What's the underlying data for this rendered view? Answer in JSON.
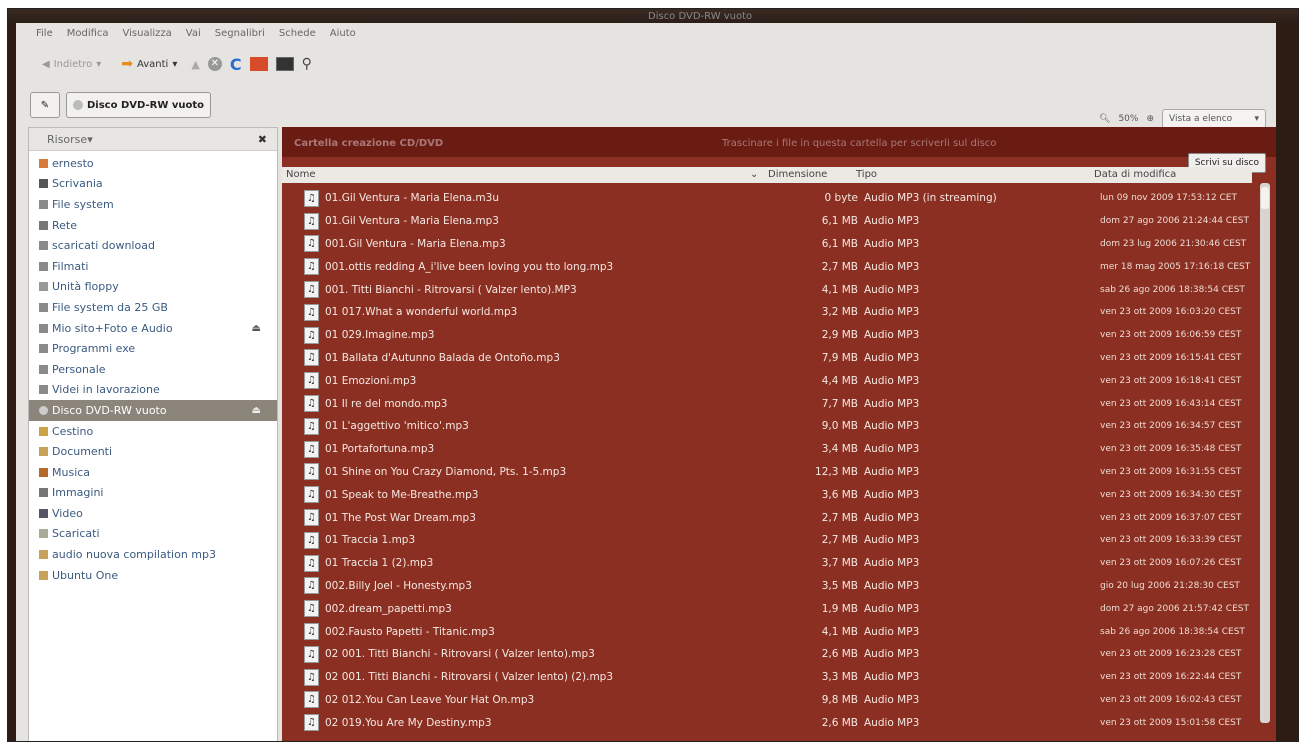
{
  "window": {
    "title": "Disco DVD-RW vuoto"
  },
  "menu": [
    "File",
    "Modifica",
    "Visualizza",
    "Vai",
    "Segnalibri",
    "Schede",
    "Aiuto"
  ],
  "toolbar": {
    "back": "Indietro",
    "forward": "Avanti"
  },
  "path": {
    "location": "Disco DVD-RW vuoto"
  },
  "view": {
    "zoom": "50%",
    "mode": "Vista a elenco"
  },
  "sidebar": {
    "header": "Risorse",
    "items": [
      {
        "label": "ernesto",
        "icon": "home-icon"
      },
      {
        "label": "Scrivania",
        "icon": "desktop-icon"
      },
      {
        "label": "File system",
        "icon": "drive-icon"
      },
      {
        "label": "Rete",
        "icon": "network-icon"
      },
      {
        "label": "scaricati download",
        "icon": "drive-icon"
      },
      {
        "label": "Filmati",
        "icon": "drive-icon"
      },
      {
        "label": "Unità floppy",
        "icon": "floppy-icon"
      },
      {
        "label": "File system da 25 GB",
        "icon": "drive-icon"
      },
      {
        "label": "Mio sito+Foto e Audio",
        "icon": "drive-icon",
        "eject": true
      },
      {
        "label": "Programmi exe",
        "icon": "drive-icon"
      },
      {
        "label": "Personale",
        "icon": "drive-icon"
      },
      {
        "label": "Videi in lavorazione",
        "icon": "drive-icon"
      },
      {
        "label": "Disco DVD-RW vuoto",
        "icon": "disc-icon",
        "eject": true,
        "selected": true
      },
      {
        "label": "Cestino",
        "icon": "trash-icon"
      },
      {
        "label": "Documenti",
        "icon": "folder-icon"
      },
      {
        "label": "Musica",
        "icon": "music-folder-icon"
      },
      {
        "label": "Immagini",
        "icon": "images-folder-icon"
      },
      {
        "label": "Video",
        "icon": "video-folder-icon"
      },
      {
        "label": "Scaricati",
        "icon": "downloads-folder-icon"
      },
      {
        "label": "audio nuova compilation mp3",
        "icon": "folder-icon"
      },
      {
        "label": "Ubuntu One",
        "icon": "folder-icon"
      }
    ]
  },
  "content": {
    "bar_title": "Cartella creazione CD/DVD",
    "bar_message": "Trascinare i file in questa cartella per scriverli sul disco",
    "write_button": "Scrivi su disco",
    "columns": {
      "name": "Nome",
      "size": "Dimensione",
      "type": "Tipo",
      "date": "Data di modifica"
    },
    "files": [
      {
        "name": "01.Gil Ventura - Maria Elena.m3u",
        "size": "0 byte",
        "type": "Audio MP3 (in streaming)",
        "date": "lun 09 nov 2009 17:53:12 CET"
      },
      {
        "name": "01.Gil Ventura - Maria Elena.mp3",
        "size": "6,1 MB",
        "type": "Audio MP3",
        "date": "dom 27 ago 2006 21:24:44 CEST"
      },
      {
        "name": "001.Gil Ventura - Maria Elena.mp3",
        "size": "6,1 MB",
        "type": "Audio MP3",
        "date": "dom 23 lug 2006 21:30:46 CEST"
      },
      {
        "name": "001.ottis redding A_i'live been loving you tto long.mp3",
        "size": "2,7 MB",
        "type": "Audio MP3",
        "date": "mer 18 mag 2005 17:16:18 CEST"
      },
      {
        "name": "001. Titti Bianchi - Ritrovarsi ( Valzer lento).MP3",
        "size": "4,1 MB",
        "type": "Audio MP3",
        "date": "sab 26 ago 2006 18:38:54 CEST"
      },
      {
        "name": "01 017.What a wonderful world.mp3",
        "size": "3,2 MB",
        "type": "Audio MP3",
        "date": "ven 23 ott 2009 16:03:20 CEST"
      },
      {
        "name": "01 029.Imagine.mp3",
        "size": "2,9 MB",
        "type": "Audio MP3",
        "date": "ven 23 ott 2009 16:06:59 CEST"
      },
      {
        "name": "01 Ballata d'Autunno Balada de Ontoño.mp3",
        "size": "7,9 MB",
        "type": "Audio MP3",
        "date": "ven 23 ott 2009 16:15:41 CEST"
      },
      {
        "name": "01 Emozioni.mp3",
        "size": "4,4 MB",
        "type": "Audio MP3",
        "date": "ven 23 ott 2009 16:18:41 CEST"
      },
      {
        "name": "01 Il re del mondo.mp3",
        "size": "7,7 MB",
        "type": "Audio MP3",
        "date": "ven 23 ott 2009 16:43:14 CEST"
      },
      {
        "name": "01 L'aggettivo 'mitico'.mp3",
        "size": "9,0 MB",
        "type": "Audio MP3",
        "date": "ven 23 ott 2009 16:34:57 CEST"
      },
      {
        "name": "01 Portafortuna.mp3",
        "size": "3,4 MB",
        "type": "Audio MP3",
        "date": "ven 23 ott 2009 16:35:48 CEST"
      },
      {
        "name": "01 Shine on You Crazy Diamond, Pts. 1-5.mp3",
        "size": "12,3 MB",
        "type": "Audio MP3",
        "date": "ven 23 ott 2009 16:31:55 CEST"
      },
      {
        "name": "01 Speak to Me-Breathe.mp3",
        "size": "3,6 MB",
        "type": "Audio MP3",
        "date": "ven 23 ott 2009 16:34:30 CEST"
      },
      {
        "name": "01 The Post War Dream.mp3",
        "size": "2,7 MB",
        "type": "Audio MP3",
        "date": "ven 23 ott 2009 16:37:07 CEST"
      },
      {
        "name": "01 Traccia 1.mp3",
        "size": "2,7 MB",
        "type": "Audio MP3",
        "date": "ven 23 ott 2009 16:33:39 CEST"
      },
      {
        "name": "01 Traccia 1 (2).mp3",
        "size": "3,7 MB",
        "type": "Audio MP3",
        "date": "ven 23 ott 2009 16:07:26 CEST"
      },
      {
        "name": "002.Billy Joel - Honesty.mp3",
        "size": "3,5 MB",
        "type": "Audio MP3",
        "date": "gio 20 lug 2006 21:28:30 CEST"
      },
      {
        "name": "002.dream_papetti.mp3",
        "size": "1,9 MB",
        "type": "Audio MP3",
        "date": "dom 27 ago 2006 21:57:42 CEST"
      },
      {
        "name": "002.Fausto Papetti - Titanic.mp3",
        "size": "4,1 MB",
        "type": "Audio MP3",
        "date": "sab 26 ago 2006 18:38:54 CEST"
      },
      {
        "name": "02 001. Titti Bianchi - Ritrovarsi ( Valzer lento).mp3",
        "size": "2,6 MB",
        "type": "Audio MP3",
        "date": "ven 23 ott 2009 16:23:28 CEST"
      },
      {
        "name": "02 001. Titti Bianchi - Ritrovarsi ( Valzer lento) (2).mp3",
        "size": "3,3 MB",
        "type": "Audio MP3",
        "date": "ven 23 ott 2009 16:22:44 CEST"
      },
      {
        "name": "02 012.You Can Leave Your Hat On.mp3",
        "size": "9,8 MB",
        "type": "Audio MP3",
        "date": "ven 23 ott 2009 16:02:43 CEST"
      },
      {
        "name": "02 019.You Are My Destiny.mp3",
        "size": "2,6 MB",
        "type": "Audio MP3",
        "date": "ven 23 ott 2009 15:01:58 CEST"
      }
    ]
  },
  "colors": {
    "content_bg": "#8a2f22",
    "sidebar_selected": "#8c857c",
    "link_text": "#3b5a80"
  }
}
